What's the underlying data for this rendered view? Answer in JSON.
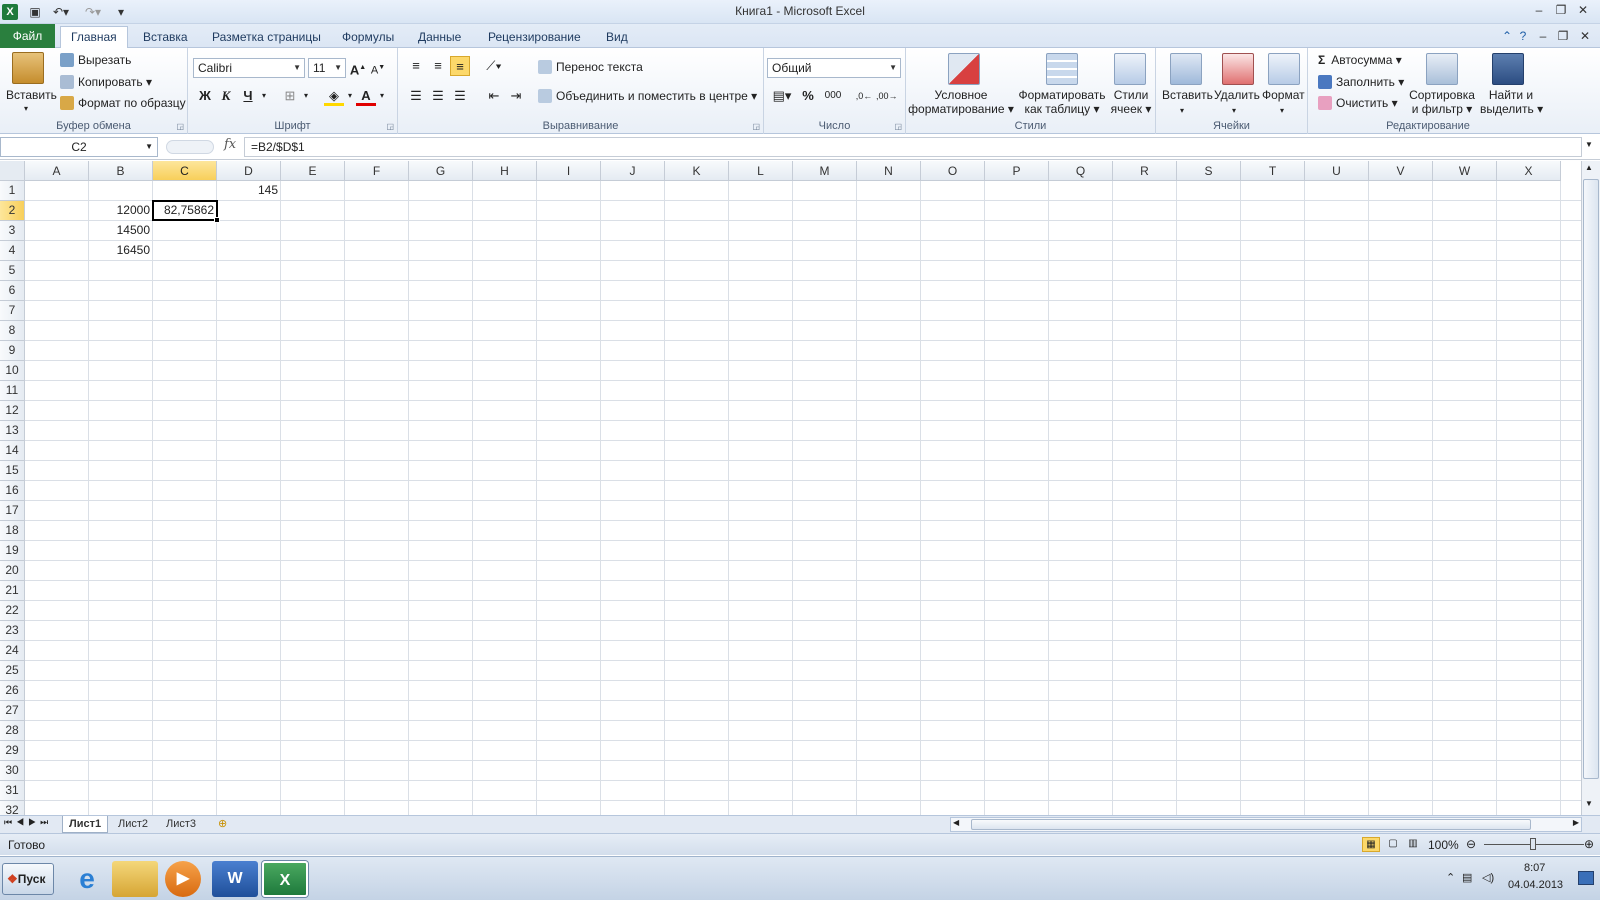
{
  "window": {
    "title": "Книга1  -  Microsoft Excel"
  },
  "tabs": [
    "Файл",
    "Главная",
    "Вставка",
    "Разметка страницы",
    "Формулы",
    "Данные",
    "Рецензирование",
    "Вид"
  ],
  "ribbon": {
    "clipboard": {
      "paste": "Вставить",
      "cut": "Вырезать",
      "copy": "Копировать",
      "format_painter": "Формат по образцу",
      "label": "Буфер обмена"
    },
    "font": {
      "name": "Calibri",
      "size": "11",
      "bold": "Ж",
      "italic": "К",
      "underline": "Ч",
      "label": "Шрифт"
    },
    "alignment": {
      "wrap": "Перенос текста",
      "merge": "Объединить и поместить в центре",
      "label": "Выравнивание"
    },
    "number": {
      "format": "Общий",
      "percent": "%",
      "thousands": "000",
      "label": "Число"
    },
    "styles": {
      "conditional": "Условное",
      "conditional2": "форматирование",
      "table": "Форматировать",
      "table2": "как таблицу",
      "cell": "Стили",
      "cell2": "ячеек",
      "label": "Стили"
    },
    "cells": {
      "insert": "Вставить",
      "delete": "Удалить",
      "format": "Формат",
      "label": "Ячейки"
    },
    "editing": {
      "autosum": "Автосумма",
      "fill": "Заполнить",
      "clear": "Очистить",
      "sort": "Сортировка",
      "sort2": "и фильтр",
      "find": "Найти и",
      "find2": "выделить",
      "label": "Редактирование"
    }
  },
  "formula_bar": {
    "name_box": "C2",
    "fx": "fx",
    "formula": "=B2/$D$1"
  },
  "columns": [
    "A",
    "B",
    "C",
    "D",
    "E",
    "F",
    "G",
    "H",
    "I",
    "J",
    "K",
    "L",
    "M",
    "N",
    "O",
    "P",
    "Q",
    "R",
    "S",
    "T",
    "U",
    "V",
    "W",
    "X"
  ],
  "rows": [
    "1",
    "2",
    "3",
    "4",
    "5",
    "6",
    "7",
    "8",
    "9",
    "10",
    "11",
    "12",
    "13",
    "14",
    "15",
    "16",
    "17",
    "18",
    "19",
    "20",
    "21",
    "22",
    "23",
    "24",
    "25",
    "26",
    "27",
    "28",
    "29",
    "30",
    "31",
    "32"
  ],
  "cells": {
    "D1": "145",
    "B2": "12000",
    "C2": "82,75862",
    "B3": "14500",
    "B4": "16450"
  },
  "sheets": [
    "Лист1",
    "Лист2",
    "Лист3"
  ],
  "status": {
    "ready": "Готово",
    "zoom": "100%"
  },
  "taskbar": {
    "start": "Пуск",
    "time": "8:07",
    "date": "04.04.2013"
  }
}
